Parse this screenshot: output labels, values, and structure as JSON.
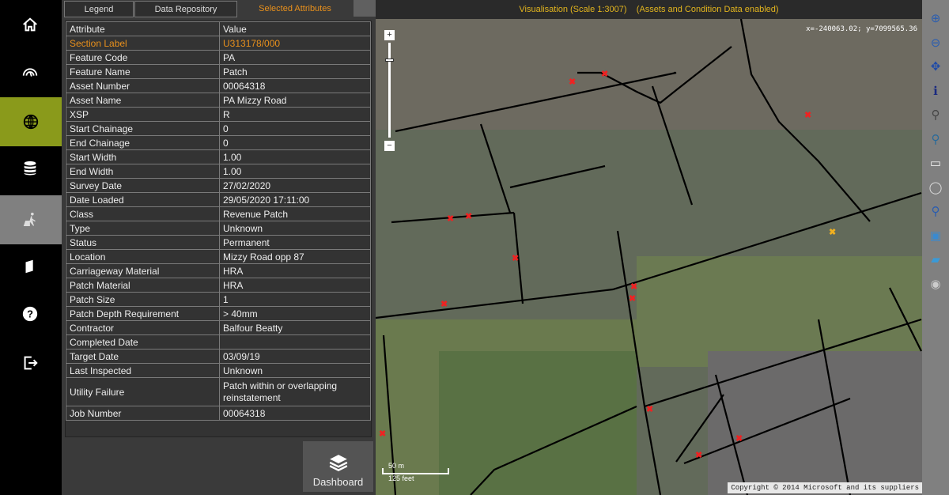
{
  "sidebar": {
    "items": [
      {
        "icon": "home-icon"
      },
      {
        "icon": "gauge-icon"
      },
      {
        "icon": "globe-icon",
        "active": true
      },
      {
        "icon": "database-icon"
      },
      {
        "icon": "worker-icon",
        "selected": true
      },
      {
        "icon": "book-icon"
      },
      {
        "icon": "help-icon"
      },
      {
        "icon": "exit-icon"
      }
    ],
    "active_color": "#8a9a1b"
  },
  "tabs": [
    {
      "label": "Legend"
    },
    {
      "label": "Data Repository"
    },
    {
      "label": "Selected Attributes",
      "active": true
    }
  ],
  "table": {
    "headers": [
      "Attribute",
      "Value"
    ],
    "rows": [
      [
        "Section Label",
        "U313178/000"
      ],
      [
        "Feature Code",
        "PA"
      ],
      [
        "Feature Name",
        "Patch"
      ],
      [
        "Asset Number",
        "00064318"
      ],
      [
        "Asset Name",
        "PA Mizzy Road"
      ],
      [
        "XSP",
        "R"
      ],
      [
        "Start Chainage",
        "0"
      ],
      [
        "End Chainage",
        "0"
      ],
      [
        "Start Width",
        "1.00"
      ],
      [
        "End Width",
        "1.00"
      ],
      [
        "Survey Date",
        "27/02/2020"
      ],
      [
        "Date Loaded",
        "29/05/2020 17:11:00"
      ],
      [
        "Class",
        "Revenue Patch"
      ],
      [
        "Type",
        "Unknown"
      ],
      [
        "Status",
        "Permanent"
      ],
      [
        "Location",
        "Mizzy Road opp 87"
      ],
      [
        "Carriageway Material",
        "HRA"
      ],
      [
        "Patch Material",
        "HRA"
      ],
      [
        "Patch Size",
        "1"
      ],
      [
        "Patch Depth Requirement",
        "> 40mm"
      ],
      [
        "Contractor",
        "Balfour Beatty"
      ],
      [
        "Completed Date",
        ""
      ],
      [
        "Target Date",
        "03/09/19"
      ],
      [
        "Last Inspected",
        "Unknown"
      ],
      [
        "Utility Failure",
        "Patch within or overlapping reinstatement"
      ],
      [
        "Job Number",
        "00064318"
      ]
    ]
  },
  "dashboard": {
    "label": "Dashboard"
  },
  "map": {
    "title": "Visualisation (Scale 1:3007)    (Assets and Condition Data enabled)",
    "coords": "x=-240063.02; y=7099565.36",
    "copyright": "Copyright © 2014 Microsoft and its suppliers",
    "scale_m": "50 m",
    "scale_ft": "125 feet",
    "zoom_in": "+",
    "zoom_out": "−"
  },
  "toolbar": [
    {
      "icon": "zoom-in-icon",
      "glyph": "⊕"
    },
    {
      "icon": "zoom-out-icon",
      "glyph": "⊖"
    },
    {
      "icon": "pan-icon",
      "glyph": "✥"
    },
    {
      "icon": "info-icon",
      "glyph": "ℹ"
    },
    {
      "icon": "binoculars-icon",
      "glyph": "⚲"
    },
    {
      "icon": "binoculars-color-icon",
      "glyph": "⚲"
    },
    {
      "icon": "ruler-icon",
      "glyph": "▭"
    },
    {
      "icon": "select-icon",
      "glyph": "◯"
    },
    {
      "icon": "search-layer-icon",
      "glyph": "⚲"
    },
    {
      "icon": "image-layer-icon",
      "glyph": "▣"
    },
    {
      "icon": "folder-star-icon",
      "glyph": "▰"
    },
    {
      "icon": "globe-print-icon",
      "glyph": "◉"
    }
  ]
}
